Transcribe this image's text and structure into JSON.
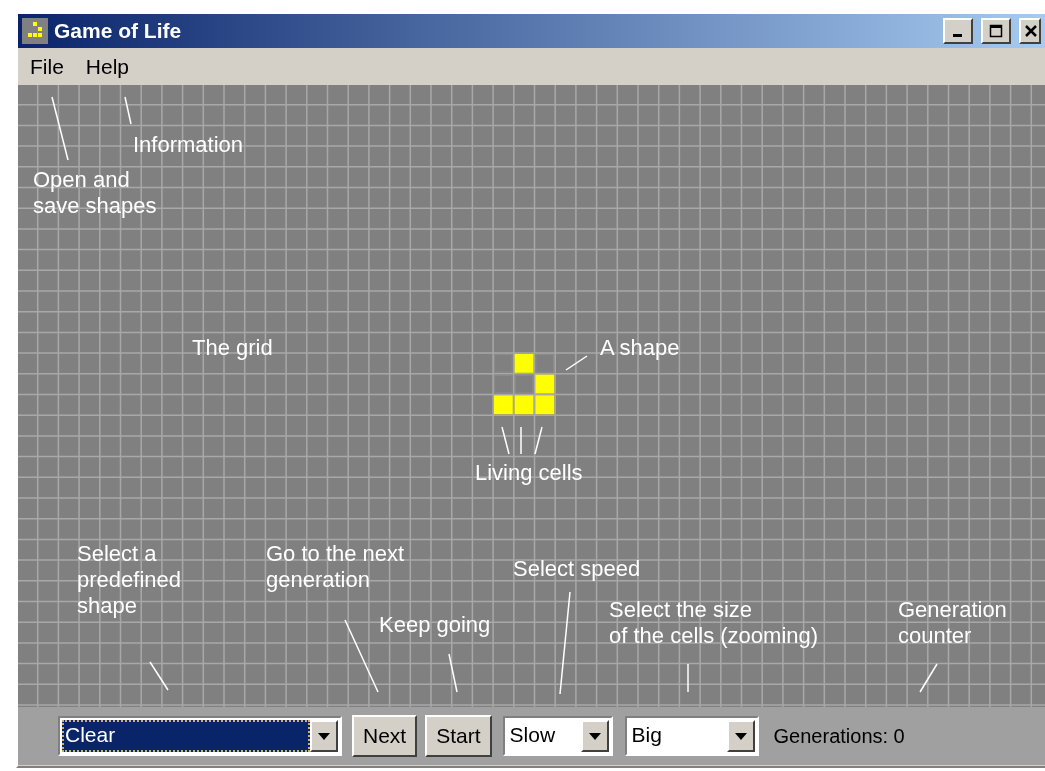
{
  "window": {
    "title": "Game of Life"
  },
  "menu": [
    {
      "label": "File"
    },
    {
      "label": "Help"
    }
  ],
  "grid": {
    "shape": {
      "rows": [
        {
          "cells": [
            {
              "alive": false
            },
            {
              "alive": true
            },
            {
              "alive": false
            }
          ]
        },
        {
          "cells": [
            {
              "alive": false
            },
            {
              "alive": false
            },
            {
              "alive": true
            }
          ]
        },
        {
          "cells": [
            {
              "alive": true
            },
            {
              "alive": true
            },
            {
              "alive": true
            }
          ]
        }
      ]
    }
  },
  "annotations": [
    {
      "text": "Open and\nsave shapes"
    },
    {
      "text": "Information"
    },
    {
      "text": "The grid"
    },
    {
      "text": "A shape"
    },
    {
      "text": "Living cells"
    },
    {
      "text": "Select a\npredefined\nshape"
    },
    {
      "text": "Go to the next\ngeneration"
    },
    {
      "text": "Keep going"
    },
    {
      "text": "Select speed"
    },
    {
      "text": "Select the size\nof the cells (zooming)"
    },
    {
      "text": "Generation\ncounter"
    }
  ],
  "toolbar": {
    "shape_select": {
      "value": "Clear",
      "focused": true
    },
    "next_button": "Next",
    "start_button": "Start",
    "speed_select": {
      "value": "Slow",
      "focused": false
    },
    "size_select": {
      "value": "Big",
      "focused": false
    },
    "generation_counter": "Generations: 0"
  }
}
